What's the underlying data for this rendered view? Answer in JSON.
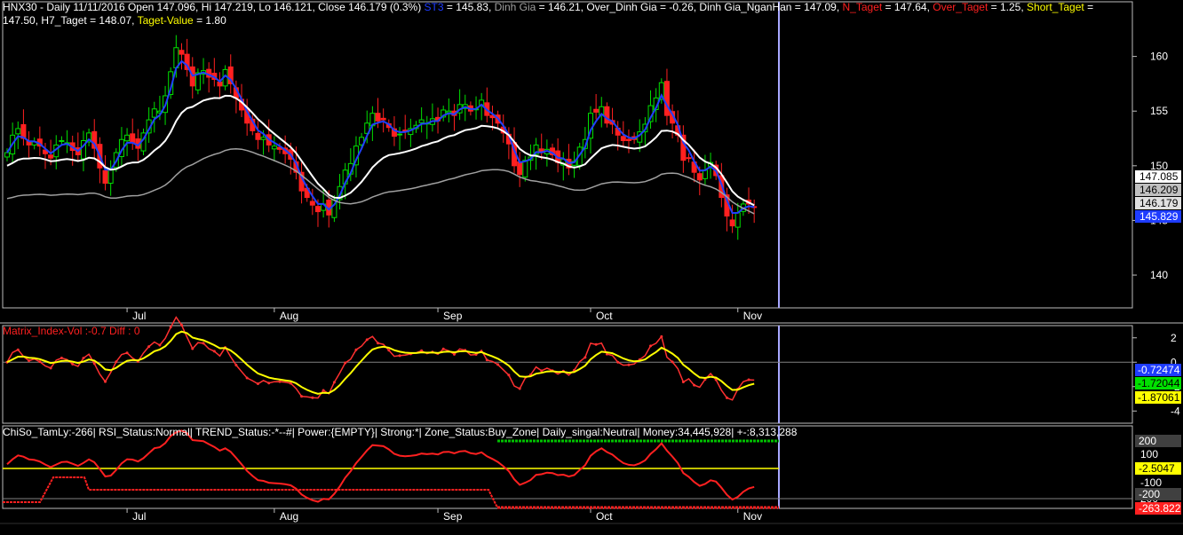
{
  "header": {
    "line1": [
      {
        "text": "HNX30 - Daily 11/11/2016 Open 147.096, Hi 147.219, Lo 146.121, Close 146.179 (0.3%) ",
        "color": "#ffffff"
      },
      {
        "text": "ST3",
        "color": "#1e3cff"
      },
      {
        "text": " = 145.83, ",
        "color": "#ffffff"
      },
      {
        "text": "Dinh Gia",
        "color": "#a0a0a0"
      },
      {
        "text": " = 146.21, Over_Dinh Gia = -0.26, Dinh Gia_NganHan = 147.09, ",
        "color": "#ffffff"
      },
      {
        "text": "N_Taget",
        "color": "#ff2020"
      },
      {
        "text": " = 147.64, ",
        "color": "#ffffff"
      },
      {
        "text": "Over_Taget",
        "color": "#ff2020"
      },
      {
        "text": " = 1.25, ",
        "color": "#ffffff"
      },
      {
        "text": "Short_Taget",
        "color": "#ffff00"
      },
      {
        "text": " =",
        "color": "#ffffff"
      }
    ],
    "line2": [
      {
        "text": "147.50, H7_Taget = 148.07, ",
        "color": "#ffffff"
      },
      {
        "text": "Taget-Value",
        "color": "#ffff00"
      },
      {
        "text": " = 1.80",
        "color": "#ffffff"
      }
    ]
  },
  "panel2_title": {
    "text": "Matrix_Index-Vol :-0.7  Diff : 0",
    "color": "#ff2020"
  },
  "panel3_title": {
    "text": "ChiSo_TamLy:-266| RSI_Status:Normal| TREND_Status:-*--#| Power:{EMPTY}| Strong:*| Zone_Status:Buy_Zone| Daily_singal:Neutral| Money:34,445,928| +-:8,313,288",
    "color": "#ffffff"
  },
  "colors": {
    "up_candle": "#00e000",
    "down_candle": "#ff2020",
    "st3": "#2040ff",
    "dinh_gia_nganhan": "#ffffff",
    "dinh_gia": "#a0a0a0",
    "cursor": "#a8a8ff",
    "grid": "#3a3a3a",
    "axis_text": "#ffffff"
  },
  "chart_data": [
    {
      "type": "candlestick",
      "symbol": "HNX30",
      "x_labels": [
        "Jul",
        "Aug",
        "Sep",
        "Oct",
        "Nov"
      ],
      "ylim": [
        137,
        165
      ],
      "yticks": [
        140,
        145,
        150,
        155,
        160
      ],
      "last_bar": {
        "date": "11/11/2016",
        "open": 147.096,
        "high": 147.219,
        "low": 146.121,
        "close": 146.179,
        "change_pct": 0.3
      },
      "price_tags": [
        {
          "value": "147.085",
          "bg": "#ffffff",
          "fg": "#000000"
        },
        {
          "value": "146.209",
          "bg": "#c0c0c0",
          "fg": "#000000"
        },
        {
          "value": "146.179",
          "bg": "#e0e0e0",
          "fg": "#000000"
        },
        {
          "value": "145.829",
          "bg": "#1e3cff",
          "fg": "#ffffff"
        }
      ],
      "closes": [
        151.2,
        152.8,
        153.4,
        152.5,
        151.9,
        152.2,
        151.8,
        151.1,
        150.7,
        151.9,
        152.3,
        152.1,
        151.4,
        151.0,
        152.3,
        153.0,
        151.6,
        149.8,
        148.4,
        149.6,
        151.2,
        152.4,
        152.8,
        152.1,
        151.6,
        153.0,
        154.2,
        155.2,
        155.0,
        156.4,
        158.6,
        160.8,
        160.2,
        158.8,
        157.3,
        158.5,
        158.7,
        158.1,
        157.9,
        157.3,
        158.8,
        157.5,
        156.2,
        155.1,
        153.9,
        153.2,
        152.4,
        152.6,
        151.9,
        151.8,
        151.5,
        151.1,
        150.6,
        149.4,
        147.7,
        147.1,
        146.4,
        145.8,
        146.5,
        145.5,
        146.9,
        148.1,
        149.6,
        150.2,
        151.8,
        152.6,
        153.9,
        154.8,
        154.1,
        154.2,
        153.5,
        152.7,
        152.9,
        153.1,
        153.4,
        153.7,
        154.2,
        153.9,
        154.3,
        154.1,
        155.1,
        155.0,
        154.6,
        155.6,
        155.6,
        155.0,
        155.2,
        156.0,
        154.6,
        154.4,
        153.9,
        153.0,
        152.0,
        150.0,
        149.2,
        150.5,
        150.8,
        151.9,
        151.2,
        151.5,
        151.0,
        150.3,
        150.6,
        149.8,
        150.4,
        151.7,
        152.4,
        154.8,
        154.9,
        155.4,
        153.9,
        153.8,
        152.8,
        152.3,
        152.3,
        152.4,
        153.1,
        153.8,
        155.5,
        156.2,
        157.6,
        154.6,
        153.9,
        152.8,
        150.5,
        150.7,
        149.4,
        148.7,
        149.6,
        150.3,
        149.1,
        147.1,
        145.4,
        144.5,
        145.7,
        146.5,
        146.5,
        146.18
      ],
      "st3_last": 145.83,
      "dinh_gia_nganhan_last": 147.09,
      "dinh_gia_last": 146.21
    },
    {
      "type": "line",
      "title": "Matrix_Index-Vol :-0.7  Diff : 0",
      "ylim": [
        -5,
        3
      ],
      "yticks": [
        2,
        0,
        -2,
        -4
      ],
      "tags": [
        {
          "value": "-0.72474",
          "bg": "#1e3cff",
          "fg": "#ffffff"
        },
        {
          "value": "-1.72044",
          "bg": "#00e000",
          "fg": "#000000"
        },
        {
          "value": "-1.87061",
          "bg": "#ffff00",
          "fg": "#000000"
        }
      ]
    },
    {
      "type": "line",
      "title": "ChiSo_TamLy:-266",
      "ylim": [
        -300,
        260
      ],
      "yticks": [
        200,
        100,
        0,
        -100,
        -200,
        200
      ],
      "ytick_labels": [
        "200",
        "100",
        "0",
        "-100",
        "-200",
        "200"
      ],
      "tags": [
        {
          "value": "200",
          "bg": "#404040",
          "fg": "#ffffff"
        },
        {
          "value": "-2.5047",
          "bg": "#ffff00",
          "fg": "#000000"
        },
        {
          "value": "-200",
          "bg": "#404040",
          "fg": "#ffffff"
        },
        {
          "value": "-263.822",
          "bg": "#ff2020",
          "fg": "#ffffff"
        }
      ]
    }
  ]
}
